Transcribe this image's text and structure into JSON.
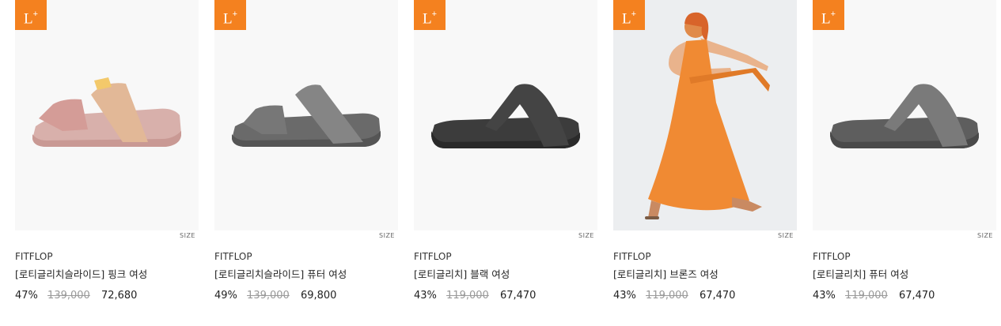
{
  "badge": {
    "label": "L",
    "superscript": "+"
  },
  "size_label": "SIZE",
  "products": [
    {
      "brand": "FITFLOP",
      "name": "[로티글리치슬라이드] 핑크 여성",
      "discount": "47%",
      "original_price": "139,000",
      "sale_price": "72,680",
      "image": "pink-slide-sandal"
    },
    {
      "brand": "FITFLOP",
      "name": "[로티글리치슬라이드] 퓨터 여성",
      "discount": "49%",
      "original_price": "139,000",
      "sale_price": "69,800",
      "image": "pewter-slide-sandal"
    },
    {
      "brand": "FITFLOP",
      "name": "[로티글리치] 블랙 여성",
      "discount": "43%",
      "original_price": "119,000",
      "sale_price": "67,470",
      "image": "black-toe-post-sandal"
    },
    {
      "brand": "FITFLOP",
      "name": "[로티글리치] 브론즈 여성",
      "discount": "43%",
      "original_price": "119,000",
      "sale_price": "67,470",
      "image": "model-orange-dress-bronze-sandal"
    },
    {
      "brand": "FITFLOP",
      "name": "[로티글리치] 퓨터 여성",
      "discount": "43%",
      "original_price": "119,000",
      "sale_price": "67,470",
      "image": "pewter-toe-post-sandal"
    }
  ],
  "colors": {
    "badge": "#f4811f",
    "strike": "#999999"
  }
}
